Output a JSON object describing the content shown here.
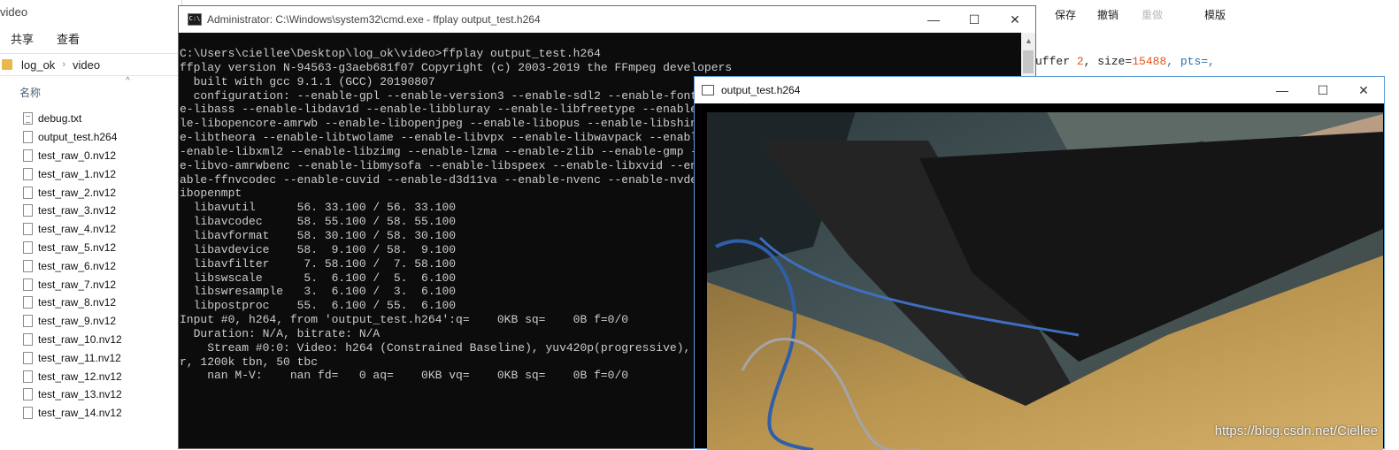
{
  "explorer": {
    "title": "video",
    "ribbon": [
      "共享",
      "查看"
    ],
    "breadcrumb": [
      "log_ok",
      "video"
    ],
    "column_header": "名称",
    "files": [
      {
        "name": "debug.txt",
        "icon": "text-file-icon"
      },
      {
        "name": "output_test.h264",
        "icon": "file-icon"
      },
      {
        "name": "test_raw_0.nv12",
        "icon": "file-icon"
      },
      {
        "name": "test_raw_1.nv12",
        "icon": "file-icon"
      },
      {
        "name": "test_raw_2.nv12",
        "icon": "file-icon"
      },
      {
        "name": "test_raw_3.nv12",
        "icon": "file-icon"
      },
      {
        "name": "test_raw_4.nv12",
        "icon": "file-icon"
      },
      {
        "name": "test_raw_5.nv12",
        "icon": "file-icon"
      },
      {
        "name": "test_raw_6.nv12",
        "icon": "file-icon"
      },
      {
        "name": "test_raw_7.nv12",
        "icon": "file-icon"
      },
      {
        "name": "test_raw_8.nv12",
        "icon": "file-icon"
      },
      {
        "name": "test_raw_9.nv12",
        "icon": "file-icon"
      },
      {
        "name": "test_raw_10.nv12",
        "icon": "file-icon"
      },
      {
        "name": "test_raw_11.nv12",
        "icon": "file-icon"
      },
      {
        "name": "test_raw_12.nv12",
        "icon": "file-icon"
      },
      {
        "name": "test_raw_13.nv12",
        "icon": "file-icon"
      },
      {
        "name": "test_raw_14.nv12",
        "icon": "file-icon"
      }
    ]
  },
  "editor": {
    "toolbar": {
      "save": "保存",
      "undo": "撤销",
      "redo": "重做",
      "template": "模版"
    },
    "code_prefix": "uffer ",
    "code_num1": "2",
    "code_mid": ", size=",
    "code_num2": "15488",
    "code_end": ", pts=,"
  },
  "cmd": {
    "title": "Administrator: C:\\Windows\\system32\\cmd.exe - ffplay  output_test.h264",
    "lines": [
      "C:\\Users\\ciellee\\Desktop\\log_ok\\video>ffplay output_test.h264",
      "ffplay version N-94563-g3aeb681f07 Copyright (c) 2003-2019 the FFmpeg developers",
      "  built with gcc 9.1.1 (GCC) 20190807",
      "  configuration: --enable-gpl --enable-version3 --enable-sdl2 --enable-fontconfig --enable-gnutls --enable-iconv --enabl",
      "e-libass --enable-libdav1d --enable-libbluray --enable-libfreetype --enable-libmp3lame --enable-libopencore-amrnb --enab",
      "le-libopencore-amrwb --enable-libopenjpeg --enable-libopus --enable-libshine --enable-libsnappy --enable-libsoxr --enabl",
      "e-libtheora --enable-libtwolame --enable-libvpx --enable-libwavpack --enable-libwebp --enable-libx264 --enable-libx265 -",
      "-enable-libxml2 --enable-libzimg --enable-lzma --enable-zlib --enable-gmp --enable-libvidstab --enable-libvorbis --enabl",
      "e-libvo-amrwbenc --enable-libmysofa --enable-libspeex --enable-libxvid --enable-libaom --enable-libmfx --enable-amf --en",
      "able-ffnvcodec --enable-cuvid --enable-d3d11va --enable-nvenc --enable-nvdec --enable-dxva2 --enable-avisynth --enable-l",
      "ibopenmpt",
      "  libavutil      56. 33.100 / 56. 33.100",
      "  libavcodec     58. 55.100 / 58. 55.100",
      "  libavformat    58. 30.100 / 58. 30.100",
      "  libavdevice    58.  9.100 / 58.  9.100",
      "  libavfilter     7. 58.100 /  7. 58.100",
      "  libswscale      5.  6.100 /  5.  6.100",
      "  libswresample   3.  6.100 /  3.  6.100",
      "  libpostproc    55.  6.100 / 55.  6.100",
      "Input #0, h264, from 'output_test.h264':q=    0KB sq=    0B f=0/0",
      "  Duration: N/A, bitrate: N/A",
      "    Stream #0:0: Video: h264 (Constrained Baseline), yuv420p(progressive), 1280x720, 50 fps, 50 tbr, 1200k tbn, 100 tbc",
      "r, 1200k tbn, 50 tbc",
      "    nan M-V:    nan fd=   0 aq=    0KB vq=    0KB sq=    0B f=0/0"
    ]
  },
  "ffplay": {
    "title": "output_test.h264"
  },
  "watermark": "https://blog.csdn.net/Ciellee"
}
